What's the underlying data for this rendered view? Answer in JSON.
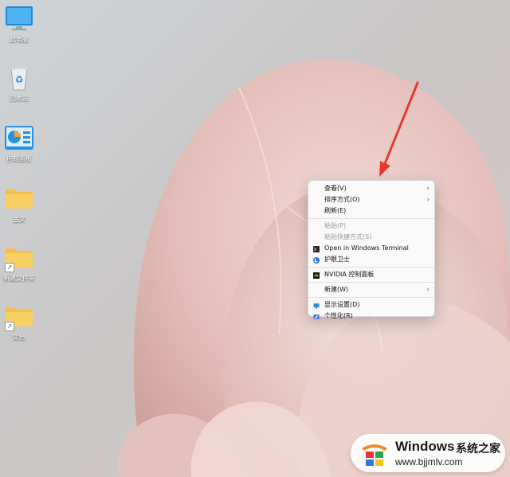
{
  "desktop": {
    "icons": [
      {
        "label": "此电脑",
        "icon": "monitor-icon"
      },
      {
        "label": "回收站",
        "icon": "recycle-bin-icon"
      },
      {
        "label": "控制面板",
        "icon": "control-panel-icon"
      },
      {
        "label": "主文",
        "icon": "folder-icon"
      },
      {
        "label": "新建文件夹",
        "icon": "folder-shortcut-icon"
      },
      {
        "label": "文档",
        "icon": "folder-shortcut-icon"
      }
    ]
  },
  "context_menu": {
    "items": [
      {
        "label": "查看(V)",
        "has_submenu": true,
        "enabled": true
      },
      {
        "label": "排序方式(O)",
        "has_submenu": true,
        "enabled": true
      },
      {
        "label": "刷新(E)",
        "enabled": true
      },
      {
        "label": "粘贴(P)",
        "enabled": false
      },
      {
        "label": "粘贴快捷方式(S)",
        "enabled": false
      },
      {
        "label": "Open in Windows Terminal",
        "icon": "terminal-icon",
        "enabled": true
      },
      {
        "label": "护眼卫士",
        "icon": "eye-guard-icon",
        "enabled": true
      },
      {
        "label": "NVIDIA 控制面板",
        "icon": "nvidia-icon",
        "enabled": true
      },
      {
        "label": "新建(W)",
        "has_submenu": true,
        "enabled": true
      },
      {
        "label": "显示设置(D)",
        "icon": "display-settings-icon",
        "enabled": true
      },
      {
        "label": "个性化(R)",
        "icon": "personalize-icon",
        "enabled": true
      }
    ]
  },
  "watermark": {
    "brand": "Windows",
    "brand_cn": "系统之家",
    "url": "www.bjjmlv.com"
  },
  "colors": {
    "annotation_arrow": "#e53a2f",
    "folder": "#f2c04b",
    "menu_bg": "#f9f9f9"
  }
}
